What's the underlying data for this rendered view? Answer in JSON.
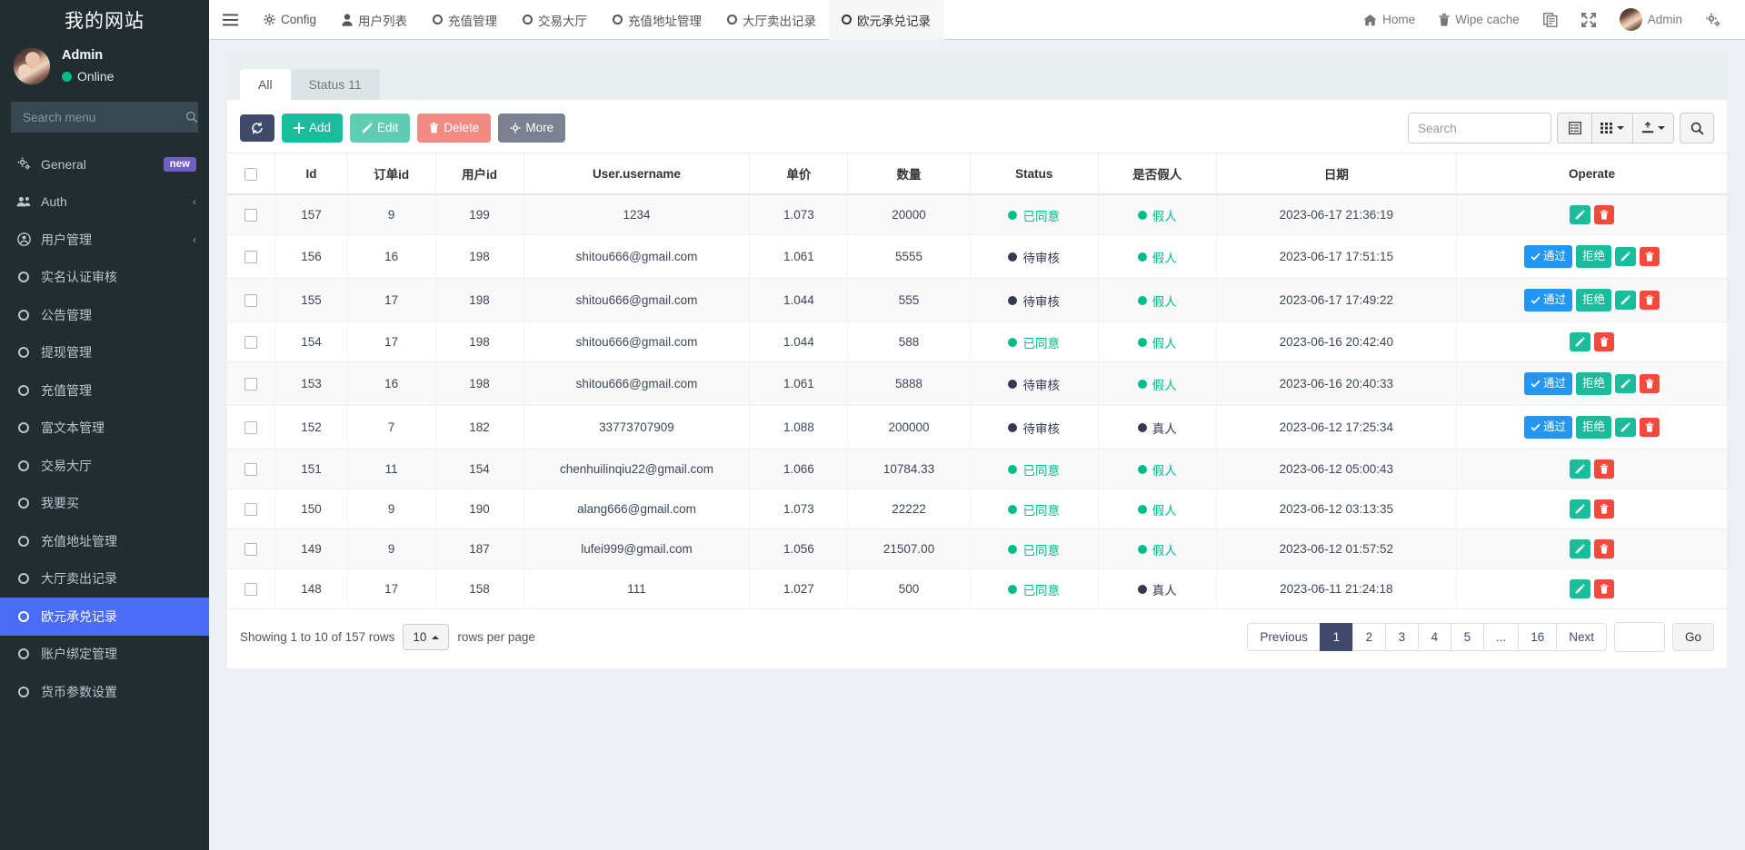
{
  "sidebar": {
    "brand": "我的网站",
    "user": {
      "name": "Admin",
      "status": "Online"
    },
    "search_placeholder": "Search menu",
    "items": [
      {
        "label": "General",
        "icon": "gears-icon",
        "badge": "new",
        "active": false
      },
      {
        "label": "Auth",
        "icon": "users-icon",
        "chevron": "‹",
        "active": false
      },
      {
        "label": "用户管理",
        "icon": "user-circle-icon",
        "chevron": "‹",
        "active": false
      },
      {
        "label": "实名认证审核",
        "icon": "circle-icon",
        "active": false
      },
      {
        "label": "公告管理",
        "icon": "circle-icon",
        "active": false
      },
      {
        "label": "提现管理",
        "icon": "circle-icon",
        "active": false
      },
      {
        "label": "充值管理",
        "icon": "circle-icon",
        "active": false
      },
      {
        "label": "富文本管理",
        "icon": "circle-icon",
        "active": false
      },
      {
        "label": "交易大厅",
        "icon": "circle-icon",
        "active": false
      },
      {
        "label": "我要买",
        "icon": "circle-icon",
        "active": false
      },
      {
        "label": "充值地址管理",
        "icon": "circle-icon",
        "active": false
      },
      {
        "label": "大厅卖出记录",
        "icon": "circle-icon",
        "active": false
      },
      {
        "label": "欧元承兑记录",
        "icon": "circle-icon",
        "active": true
      },
      {
        "label": "账户绑定管理",
        "icon": "circle-icon",
        "active": false
      },
      {
        "label": "货币参数设置",
        "icon": "circle-icon",
        "active": false
      }
    ]
  },
  "topbar": {
    "menu_toggle": "hamburger-icon",
    "nav": [
      {
        "label": "Config",
        "icon": "gear-icon",
        "current": false
      },
      {
        "label": "用户列表",
        "icon": "user-icon",
        "current": false
      },
      {
        "label": "充值管理",
        "icon": "circle-icon",
        "current": false
      },
      {
        "label": "交易大厅",
        "icon": "circle-icon",
        "current": false
      },
      {
        "label": "充值地址管理",
        "icon": "circle-icon",
        "current": false
      },
      {
        "label": "大厅卖出记录",
        "icon": "circle-icon",
        "current": false
      },
      {
        "label": "欧元承兑记录",
        "icon": "circle-icon",
        "current": true
      }
    ],
    "right": [
      {
        "label": "Home",
        "icon": "home-icon"
      },
      {
        "label": "Wipe cache",
        "icon": "trash-icon"
      },
      {
        "label": "",
        "icon": "copy-icon"
      },
      {
        "label": "",
        "icon": "fullscreen-icon"
      },
      {
        "label": "Admin",
        "icon": "avatar"
      },
      {
        "label": "",
        "icon": "gears-settings-icon"
      }
    ]
  },
  "tabs": [
    {
      "label": "All",
      "active": true
    },
    {
      "label": "Status 11",
      "active": false
    }
  ],
  "toolbar": {
    "refresh_label": "",
    "add_label": "Add",
    "edit_label": "Edit",
    "delete_label": "Delete",
    "more_label": "More",
    "search_placeholder": "Search",
    "columns_icon": "list-icon",
    "grid_icon": "grid-icon",
    "export_icon": "export-icon",
    "search_icon": "search-icon"
  },
  "table": {
    "columns": [
      "",
      "Id",
      "订单id",
      "用户id",
      "User.username",
      "单价",
      "数量",
      "Status",
      "是否假人",
      "日期",
      "Operate"
    ],
    "rows": [
      {
        "id": "157",
        "order_id": "9",
        "user_id": "199",
        "username": "1234",
        "price": "1.073",
        "qty": "20000",
        "status": "已同意",
        "status_type": "green",
        "fake": "假人",
        "fake_type": "green",
        "date": "2023-06-17 21:36:19",
        "ops": [
          "edit",
          "delete"
        ]
      },
      {
        "id": "156",
        "order_id": "16",
        "user_id": "198",
        "username": "shitou666@gmail.com",
        "price": "1.061",
        "qty": "5555",
        "status": "待审核",
        "status_type": "dark",
        "fake": "假人",
        "fake_type": "green",
        "date": "2023-06-17 17:51:15",
        "ops": [
          "pass",
          "reject",
          "edit",
          "delete"
        ]
      },
      {
        "id": "155",
        "order_id": "17",
        "user_id": "198",
        "username": "shitou666@gmail.com",
        "price": "1.044",
        "qty": "555",
        "status": "待审核",
        "status_type": "dark",
        "fake": "假人",
        "fake_type": "green",
        "date": "2023-06-17 17:49:22",
        "ops": [
          "pass",
          "reject",
          "edit",
          "delete"
        ]
      },
      {
        "id": "154",
        "order_id": "17",
        "user_id": "198",
        "username": "shitou666@gmail.com",
        "price": "1.044",
        "qty": "588",
        "status": "已同意",
        "status_type": "green",
        "fake": "假人",
        "fake_type": "green",
        "date": "2023-06-16 20:42:40",
        "ops": [
          "edit",
          "delete"
        ]
      },
      {
        "id": "153",
        "order_id": "16",
        "user_id": "198",
        "username": "shitou666@gmail.com",
        "price": "1.061",
        "qty": "5888",
        "status": "待审核",
        "status_type": "dark",
        "fake": "假人",
        "fake_type": "green",
        "date": "2023-06-16 20:40:33",
        "ops": [
          "pass",
          "reject",
          "edit",
          "delete"
        ]
      },
      {
        "id": "152",
        "order_id": "7",
        "user_id": "182",
        "username": "33773707909",
        "price": "1.088",
        "qty": "200000",
        "status": "待审核",
        "status_type": "dark",
        "fake": "真人",
        "fake_type": "dark",
        "date": "2023-06-12 17:25:34",
        "ops": [
          "pass",
          "reject",
          "edit",
          "delete"
        ]
      },
      {
        "id": "151",
        "order_id": "11",
        "user_id": "154",
        "username": "chenhuilinqiu22@gmail.com",
        "price": "1.066",
        "qty": "10784.33",
        "status": "已同意",
        "status_type": "green",
        "fake": "假人",
        "fake_type": "green",
        "date": "2023-06-12 05:00:43",
        "ops": [
          "edit",
          "delete"
        ]
      },
      {
        "id": "150",
        "order_id": "9",
        "user_id": "190",
        "username": "alang666@gmail.com",
        "price": "1.073",
        "qty": "22222",
        "status": "已同意",
        "status_type": "green",
        "fake": "假人",
        "fake_type": "green",
        "date": "2023-06-12 03:13:35",
        "ops": [
          "edit",
          "delete"
        ]
      },
      {
        "id": "149",
        "order_id": "9",
        "user_id": "187",
        "username": "lufei999@gmail.com",
        "price": "1.056",
        "qty": "21507.00",
        "status": "已同意",
        "status_type": "green",
        "fake": "假人",
        "fake_type": "green",
        "date": "2023-06-12 01:57:52",
        "ops": [
          "edit",
          "delete"
        ]
      },
      {
        "id": "148",
        "order_id": "17",
        "user_id": "158",
        "username": "111",
        "price": "1.027",
        "qty": "500",
        "status": "已同意",
        "status_type": "green",
        "fake": "真人",
        "fake_type": "dark",
        "date": "2023-06-11 21:24:18",
        "ops": [
          "edit",
          "delete"
        ]
      }
    ],
    "op_labels": {
      "pass": "通过",
      "reject": "拒绝"
    }
  },
  "footer": {
    "showing_text": "Showing 1 to 10 of 157 rows",
    "rows_per_page_value": "10",
    "rows_per_page_label": "rows per page",
    "previous": "Previous",
    "next": "Next",
    "pages": [
      "1",
      "2",
      "3",
      "4",
      "5",
      "...",
      "16"
    ],
    "active_page": "1",
    "goto_value": "",
    "go_label": "Go"
  },
  "colors": {
    "sidebar_bg": "#222d32",
    "active_menu": "#4a6cf7",
    "accent_green": "#1abc9c",
    "status_green": "#00bc8c",
    "status_dark": "#343a52",
    "blue": "#2196f3",
    "red": "#ef4b3c"
  }
}
